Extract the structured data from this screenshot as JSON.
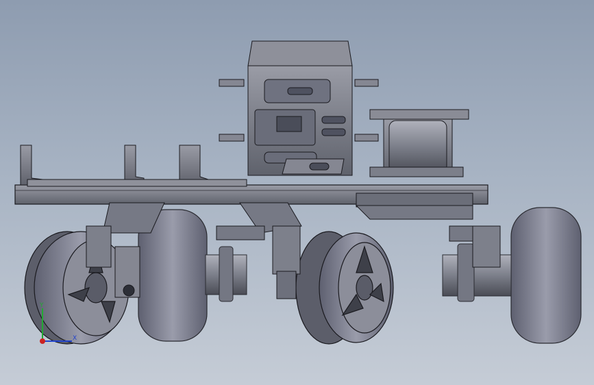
{
  "view": {
    "background_top": "#8e9cb0",
    "background_bottom": "#c5ccd6",
    "part_color": "#7d808a",
    "edge_color": "#1a1a1f"
  },
  "triad": {
    "x_label": "X",
    "y_label": "Y",
    "z_label": "Z",
    "x_color": "#2244cc",
    "y_color": "#22aa33",
    "z_color": "#cc2222"
  }
}
